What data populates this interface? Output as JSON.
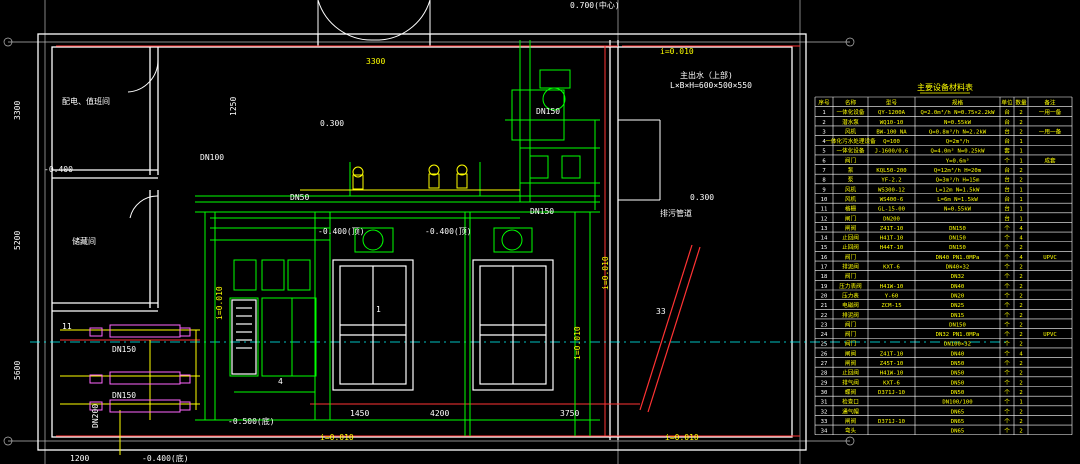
{
  "colors": {
    "background": "#000000",
    "wall": "#ffffff",
    "line_green": "#00ff00",
    "line_yellow": "#ffff00",
    "line_red": "#ff3333",
    "line_cyan": "#00ffff",
    "line_magenta": "#ff00ff",
    "text": "#ffffff"
  },
  "rooms": {
    "top_left_label": "配电、值班间",
    "mid_left_label": "储藏间",
    "right_room_note_line1": "主出水（上部)",
    "right_room_note_line2": "L×B×H=600×500×550"
  },
  "elevations": {
    "top_dim": "0.700(中心)",
    "main_floor": "0.300",
    "left_floor": "-0.400",
    "pipe_level_a": "-0.400(顶)",
    "pipe_level_b": "-0.400(顶)",
    "bottom_left": "-0.500(底)",
    "bottom_outer": "-0.400(底)",
    "right_floor": "0.300"
  },
  "dimensions": {
    "d_3300": "3300",
    "d_5200": "5200",
    "d_1450": "1450",
    "d_4200": "4200",
    "d_3750": "3750",
    "d_1250": "1250",
    "d_5600": "5600",
    "d_3300b": "3300",
    "d_1200": "1200",
    "slope_a": "i=0.010",
    "slope_b": "i=0.010",
    "slope_c": "i=0.010",
    "slope_d": "i=0.010",
    "slope_e": "i=0.010",
    "slope_f": "i=0.010"
  },
  "pipe_labels": {
    "dn150_a": "DN150",
    "dn150_b": "DN150",
    "dn150_c": "DN150",
    "dn150_d": "DN150",
    "dn200": "DN200",
    "dn100": "DN100",
    "dn50": "DN50",
    "drain": "排污管道",
    "item_1": "1",
    "item_33": "33",
    "item_11": "11",
    "item_4": "4"
  },
  "table": {
    "title": "主要设备材料表",
    "headers": [
      "序号",
      "名称",
      "型号",
      "规格",
      "单位",
      "数量",
      "备注"
    ],
    "rows": [
      [
        "1",
        "一体化设备",
        "QY-1200A",
        "Q=2.0m³/h N=0.75×2.2kW",
        "台",
        "2",
        "一用一备"
      ],
      [
        "2",
        "潜水泵",
        "WQ10-10",
        "N=0.55kW",
        "台",
        "2",
        ""
      ],
      [
        "3",
        "风机",
        "BW-100 NA",
        "Q=0.8m³/h N=2.2kW",
        "台",
        "2",
        "一用一备"
      ],
      [
        "4",
        "一体化污水处理设备",
        "Q=100",
        "Q=2m³/h",
        "台",
        "1",
        ""
      ],
      [
        "5",
        "一体化设备",
        "J-1600/0.6",
        "Q=4.0m³ N=0.25kW",
        "套",
        "1",
        ""
      ],
      [
        "6",
        "阀门",
        "",
        "Y=0.6m³",
        "个",
        "1",
        "成套"
      ],
      [
        "7",
        "泵",
        "KQL50-200",
        "Q=12m³/h H=20m",
        "台",
        "2",
        ""
      ],
      [
        "8",
        "泵",
        "YF-2.2",
        "Q=3m³/h H=15m",
        "台",
        "2",
        ""
      ],
      [
        "9",
        "风机",
        "WS300-12",
        "L=12m N=1.5kW",
        "台",
        "1",
        ""
      ],
      [
        "10",
        "风机",
        "WS400-6",
        "L=6m N=1.5kW",
        "台",
        "1",
        ""
      ],
      [
        "11",
        "格栅",
        "GL-15-00",
        "N=0.55kW",
        "台",
        "1",
        ""
      ],
      [
        "12",
        "闸门",
        "DN200",
        "",
        "台",
        "1",
        ""
      ],
      [
        "13",
        "闸阀",
        "Z41T-10",
        "DN150",
        "个",
        "4",
        ""
      ],
      [
        "14",
        "止回阀",
        "H41T-10",
        "DN150",
        "个",
        "4",
        ""
      ],
      [
        "15",
        "止回阀",
        "H44T-10",
        "DN150",
        "个",
        "2",
        ""
      ],
      [
        "16",
        "阀门",
        "",
        "DN40 PN1.0MPa",
        "个",
        "4",
        "UPVC"
      ],
      [
        "17",
        "排泥阀",
        "KXT-6",
        "DN40×32",
        "个",
        "2",
        ""
      ],
      [
        "18",
        "阀门",
        "",
        "DN32",
        "个",
        "2",
        ""
      ],
      [
        "19",
        "压力表阀",
        "H41W-10",
        "DN40",
        "个",
        "2",
        ""
      ],
      [
        "20",
        "压力表",
        "Y-60",
        "DN20",
        "个",
        "2",
        ""
      ],
      [
        "21",
        "电磁阀",
        "ZCM-15",
        "DN25",
        "个",
        "2",
        ""
      ],
      [
        "22",
        "排泥阀",
        "",
        "DN15",
        "个",
        "2",
        ""
      ],
      [
        "23",
        "阀门",
        "",
        "DN150",
        "个",
        "2",
        ""
      ],
      [
        "24",
        "阀门",
        "",
        "DN32 PN1.0MPa",
        "个",
        "2",
        "UPVC"
      ],
      [
        "25",
        "阀门",
        "",
        "DN100×32",
        "个",
        "2",
        ""
      ],
      [
        "26",
        "闸阀",
        "Z41T-10",
        "DN40",
        "个",
        "4",
        ""
      ],
      [
        "27",
        "闸阀",
        "Z45T-10",
        "DN50",
        "个",
        "2",
        ""
      ],
      [
        "28",
        "止回阀",
        "H41W-10",
        "DN50",
        "个",
        "2",
        ""
      ],
      [
        "29",
        "排气阀",
        "KXT-6",
        "DN50",
        "个",
        "2",
        ""
      ],
      [
        "30",
        "蝶阀",
        "D371J-10",
        "DN50",
        "个",
        "2",
        ""
      ],
      [
        "31",
        "检查口",
        "",
        "DN100/100",
        "个",
        "1",
        ""
      ],
      [
        "32",
        "通气帽",
        "",
        "DN65",
        "个",
        "2",
        ""
      ],
      [
        "33",
        "闸阀",
        "D371J-10",
        "DN65",
        "个",
        "2",
        ""
      ],
      [
        "34",
        "弯头",
        "",
        "DN65",
        "个",
        "2",
        ""
      ]
    ]
  }
}
